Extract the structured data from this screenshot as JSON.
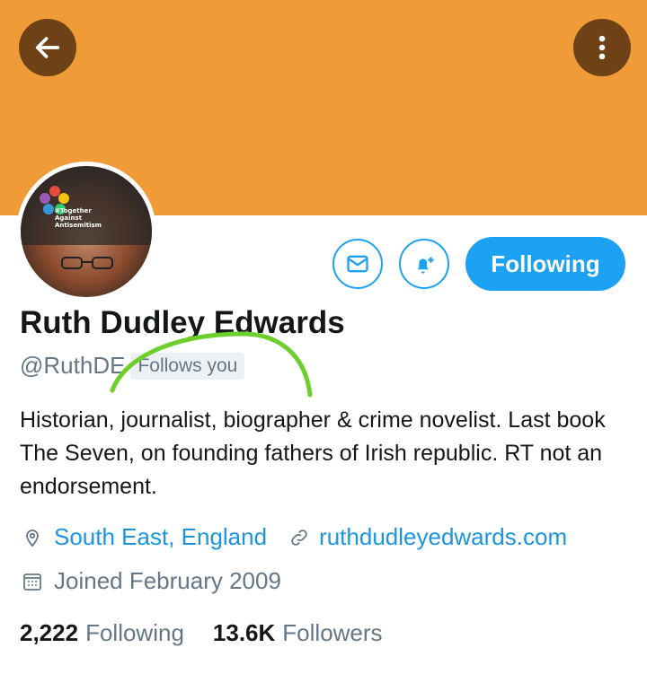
{
  "header": {
    "back_icon": "arrow-left-icon",
    "more_icon": "vertical-dots-icon",
    "banner_color": "#ef9c38"
  },
  "profile": {
    "avatar_caption": "#Together Against Antisemitism",
    "name": "Ruth Dudley Edwards",
    "handle": "@RuthDE",
    "follows_you": "Follows you",
    "bio": "Historian, journalist, biographer & crime novelist.  Last book The Seven, on founding fathers of Irish republic.  RT not an endorsement.",
    "location": "South East, England",
    "website": "ruthdudleyedwards.com",
    "joined": "Joined February 2009"
  },
  "actions": {
    "message_icon": "envelope-icon",
    "notify_icon": "bell-plus-icon",
    "following_label": "Following",
    "accent_color": "#1da1f2"
  },
  "stats": {
    "following_count": "2,222",
    "following_label": "Following",
    "followers_count": "13.6K",
    "followers_label": "Followers"
  }
}
